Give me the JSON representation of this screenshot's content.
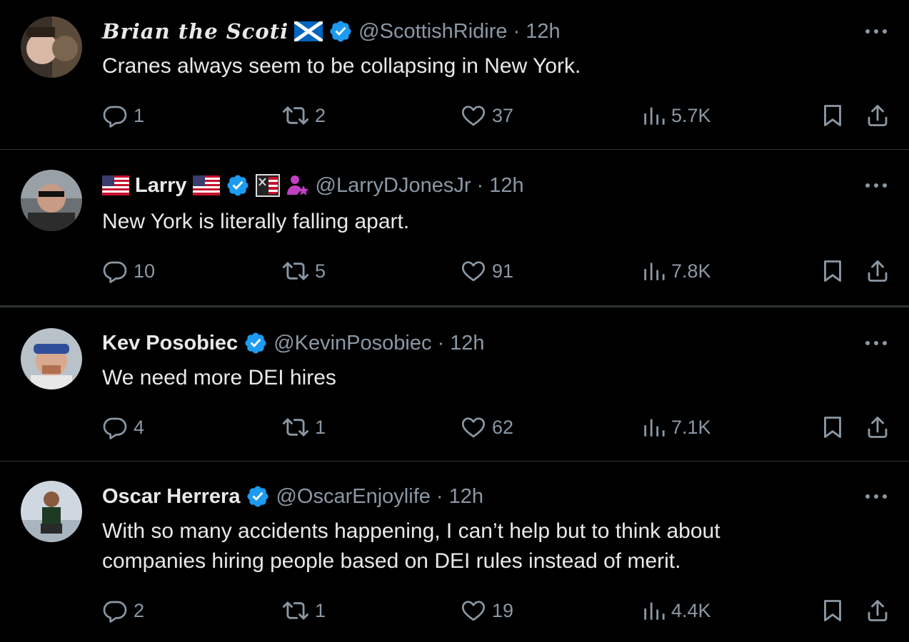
{
  "tweets": [
    {
      "name": "Brian the Scoti",
      "handle": "@ScottishRidire",
      "time": "12h",
      "text": "Cranes always seem to be collapsing in New York.",
      "replies": "1",
      "retweets": "2",
      "likes": "37",
      "views": "5.7K"
    },
    {
      "name": "Larry",
      "handle": "@LarryDJonesJr",
      "time": "12h",
      "text": "New York is literally falling apart.",
      "replies": "10",
      "retweets": "5",
      "likes": "91",
      "views": "7.8K"
    },
    {
      "name": "Kev Posobiec",
      "handle": "@KevinPosobiec",
      "time": "12h",
      "text": "We need more DEI hires",
      "replies": "4",
      "retweets": "1",
      "likes": "62",
      "views": "7.1K"
    },
    {
      "name": "Oscar Herrera",
      "handle": "@OscarEnjoylife",
      "time": "12h",
      "text": "With so many accidents happening, I can’t help but to think about companies hiring people based on DEI rules instead of merit.",
      "replies": "2",
      "retweets": "1",
      "likes": "19",
      "views": "4.4K"
    }
  ],
  "separator": "·",
  "icons": [
    "reply-icon",
    "retweet-icon",
    "like-icon",
    "views-icon",
    "bookmark-icon",
    "share-icon",
    "more-icon",
    "verified-badge-icon",
    "scotland-flag-icon",
    "us-flag-icon"
  ],
  "colors": {
    "background": "#000000",
    "text": "#e7e9ea",
    "secondary": "#8b98a5",
    "verified": "#1d9bf0",
    "divider": "#2f3336"
  }
}
